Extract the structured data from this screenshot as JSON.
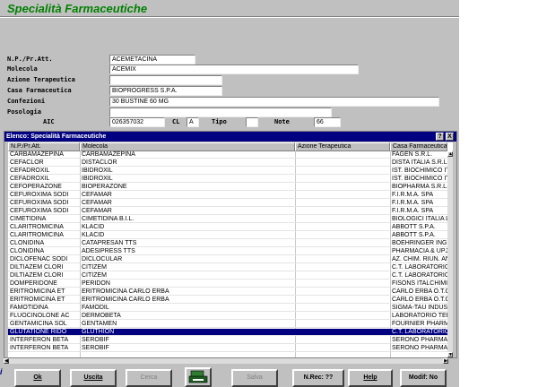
{
  "app": {
    "title": "Specialità Farmaceutiche"
  },
  "form": {
    "np_label": "N.P./Pr.Att.",
    "np_value": "ACEMETACINA",
    "molecola_label": "Molecola",
    "molecola_value": "ACEMIX",
    "azione_label": "Azione Terapeutica",
    "azione_value": "",
    "casa_label": "Casa Farmaceutica",
    "casa_value": "BIOPROGRESS S.P.A.",
    "confezioni_label": "Confezioni",
    "confezioni_value": "30 BUSTINE 60 MG",
    "posologia_label": "Posologia",
    "posologia_value": "",
    "aic_label": "AIC",
    "aic_value": "026357032",
    "cl_label": "CL",
    "cl_value": "A",
    "tipo_label": "Tipo",
    "tipo_value": "",
    "note_label": "Note",
    "note_value": "66"
  },
  "dialog": {
    "title": "Elenco: Specialità Farmaceutiche",
    "help_btn": "?",
    "close_btn": "X",
    "columns": [
      "N.P./Pr.Att.",
      "Molecola",
      "Azione Terapeutica",
      "Casa Farmaceutica"
    ],
    "rows": [
      [
        "CARBAMAZEPINA",
        "CARBAMAZEPINA",
        "",
        "FAGEN S.R.L."
      ],
      [
        "CEFACLOR",
        "DISTACLOR",
        "",
        "DISTA ITALIA S.R.L."
      ],
      [
        "CEFADROXIL",
        "IBIDROXIL",
        "",
        "IST. BIOCHIMICO ITA"
      ],
      [
        "CEFADROXIL",
        "IBIDROXIL",
        "",
        "IST. BIOCHIMICO ITA"
      ],
      [
        "CEFOPERAZONE",
        "BIOPERAZONE",
        "",
        "BIOPHARMA S.R.L."
      ],
      [
        "CEFUROXIMA SODI",
        "CEFAMAR",
        "",
        "F.I.R.M.A. SPA"
      ],
      [
        "CEFUROXIMA SODI",
        "CEFAMAR",
        "",
        "F.I.R.M.A. SPA"
      ],
      [
        "CEFUROXIMA SODI",
        "CEFAMAR",
        "",
        "F.I.R.M.A. SPA"
      ],
      [
        "CIMETIDINA",
        "CIMETIDINA B.I.L.",
        "",
        "BIOLOGICI ITALIA LA"
      ],
      [
        "CLARITROMICINA",
        "KLACID",
        "",
        "ABBOTT S.P.A."
      ],
      [
        "CLARITROMICINA",
        "KLACID",
        "",
        "ABBOTT S.P.A."
      ],
      [
        "CLONIDINA",
        "CATAPRESAN TTS",
        "",
        "BOEHRINGER INGEI"
      ],
      [
        "CLONIDINA",
        "ADESIPRESS TTS",
        "",
        "PHARMACIA & UPJO"
      ],
      [
        "DICLOFENAC SODI",
        "DICLOCULAR",
        "",
        "AZ. CHIM. RIUN. ANG"
      ],
      [
        "DILTIAZEM CLORI",
        "CITIZEM",
        "",
        "C.T. LABORATORIO"
      ],
      [
        "DILTIAZEM CLORI",
        "CITIZEM",
        "",
        "C.T. LABORATORIO"
      ],
      [
        "DOMPERIDONE",
        "PERIDON",
        "",
        "FISONS ITALCHIMIC"
      ],
      [
        "ERITROMICINA ET",
        "ERITROMICINA CARLO ERBA",
        "",
        "CARLO ERBA O.T.C."
      ],
      [
        "ERITROMICINA ET",
        "ERITROMICINA CARLO ERBA",
        "",
        "CARLO ERBA O.T.C."
      ],
      [
        "FAMOTIDINA",
        "FAMODIL",
        "",
        "SIGMA-TAU INDUST"
      ],
      [
        "FLUOCINOLONE AC",
        "DERMOBETA",
        "",
        "LABORATORIO TER."
      ],
      [
        "GENTAMICINA SOL",
        "GENTAMEN",
        "",
        "FOURNIER PHARMA"
      ],
      [
        "GLUTATIONE RIDO",
        "GLUTHION",
        "",
        "C.T. LABORATORIO"
      ],
      [
        "INTERFERON BETA",
        "SEROBIF",
        "",
        "SERONO PHARMA S"
      ],
      [
        "INTERFERON BETA",
        "SEROBIF",
        "",
        "SERONO PHARMA S"
      ]
    ],
    "selected_row": 22
  },
  "buttons": {
    "ok": "Ok",
    "uscita": "Uscita",
    "cerca": "Cerca",
    "salva": "Salva",
    "nrec": "N.Rec: ??",
    "help": "Help",
    "modif": "Modif: No"
  },
  "edge_text": "i",
  "colors": {
    "title_green": "#008000",
    "dialog_title_bg": "#000080",
    "selection": "#000080"
  }
}
